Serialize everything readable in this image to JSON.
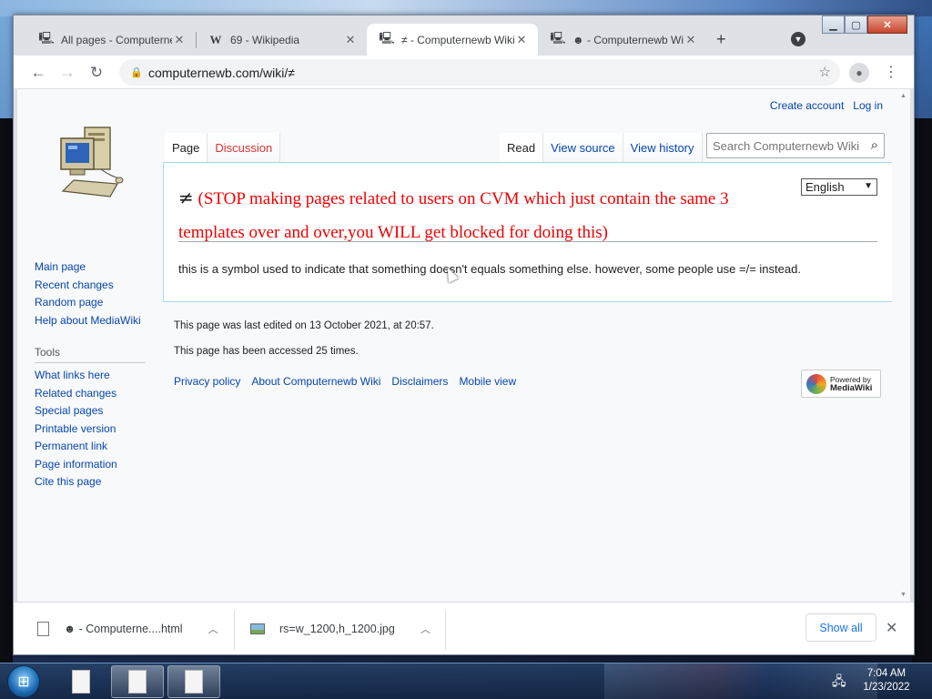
{
  "browser": {
    "tabs": [
      {
        "title": "All pages - Computernewb",
        "favicon": "computer-logo",
        "active": false
      },
      {
        "title": "69 - Wikipedia",
        "favicon": "W",
        "active": false
      },
      {
        "title": "≠ - Computernewb Wiki",
        "favicon": "computer-logo",
        "active": true
      },
      {
        "title": "☻ - Computernewb Wiki",
        "favicon": "computer-logo",
        "active": false
      }
    ],
    "url": "computernewb.com/wiki/≠"
  },
  "wiki": {
    "personal": {
      "create_account": "Create account",
      "log_in": "Log in"
    },
    "sidebar": {
      "nav": [
        "Main page",
        "Recent changes",
        "Random page",
        "Help about MediaWiki"
      ],
      "tools_heading": "Tools",
      "tools": [
        "What links here",
        "Related changes",
        "Special pages",
        "Printable version",
        "Permanent link",
        "Page information",
        "Cite this page"
      ]
    },
    "tabs": {
      "page": "Page",
      "discussion": "Discussion",
      "read": "Read",
      "view_source": "View source",
      "view_history": "View history"
    },
    "search_placeholder": "Search Computernewb Wiki",
    "language": "English",
    "title_symbol": "≠",
    "title_text": "(STOP making pages related to users on CVM which just contain the same 3 templates over and over,you WILL get blocked for doing this)",
    "body": "this is a symbol used to indicate that something doesn't equals something else. however, some people use =/= instead.",
    "last_edited": "This page was last edited on 13 October 2021, at 20:57.",
    "accessed": "This page has been accessed 25 times.",
    "footer_links": [
      "Privacy policy",
      "About Computernewb Wiki",
      "Disclaimers",
      "Mobile view"
    ],
    "powered_by": {
      "line1": "Powered by",
      "line2": "MediaWiki"
    }
  },
  "downloads": {
    "items": [
      {
        "name": "☻ - Computerne....html"
      },
      {
        "name": "rs=w_1200,h_1200.jpg"
      }
    ],
    "show_all": "Show all"
  },
  "taskbar": {
    "time": "7:04 AM",
    "date": "1/23/2022"
  }
}
